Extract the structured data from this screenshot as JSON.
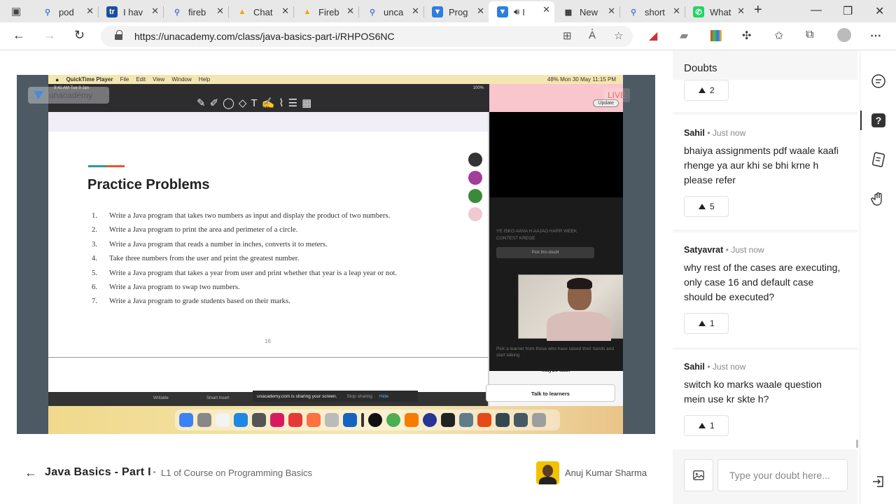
{
  "browser": {
    "tabs": [
      {
        "title": "pod",
        "icon": "search-icon",
        "fav_bg": "#e8e8e8",
        "fav_color": "#4a7bd0",
        "glyph": "⚲"
      },
      {
        "title": "I hav",
        "icon": "tr-icon",
        "fav_bg": "#1a4fa0",
        "fav_color": "#fff",
        "glyph": "tr"
      },
      {
        "title": "fireb",
        "icon": "search-icon",
        "fav_bg": "#e8e8e8",
        "fav_color": "#4a7bd0",
        "glyph": "⚲"
      },
      {
        "title": "Chat",
        "icon": "firebase-icon",
        "fav_bg": "#e8e8e8",
        "fav_color": "#f4a300",
        "glyph": "▲"
      },
      {
        "title": "Fireb",
        "icon": "firebase-icon",
        "fav_bg": "#e8e8e8",
        "fav_color": "#f4a300",
        "glyph": "▲"
      },
      {
        "title": "unca",
        "icon": "search-icon",
        "fav_bg": "#e8e8e8",
        "fav_color": "#4a7bd0",
        "glyph": "⚲"
      },
      {
        "title": "Prog",
        "icon": "unacademy-icon",
        "fav_bg": "#2f7de1",
        "fav_color": "#fff",
        "glyph": "▼"
      },
      {
        "title": "I",
        "icon": "unacademy-icon",
        "fav_bg": "#2f7de1",
        "fav_color": "#fff",
        "glyph": "▼",
        "active": true
      },
      {
        "title": "New",
        "icon": "calendar-icon",
        "fav_bg": "#e8e8e8",
        "fav_color": "#333",
        "glyph": "▦"
      },
      {
        "title": "short",
        "icon": "search-icon",
        "fav_bg": "#e8e8e8",
        "fav_color": "#4a7bd0",
        "glyph": "⚲"
      },
      {
        "title": "What",
        "icon": "whatsapp-icon",
        "fav_bg": "#25d366",
        "fav_color": "#fff",
        "glyph": "✆"
      }
    ],
    "url": "https://unacademy.com/class/java-basics-part-i/RHPOS6NC"
  },
  "video": {
    "mac_menu": [
      "QuickTime Player",
      "File",
      "Edit",
      "View",
      "Window",
      "Help"
    ],
    "mac_status": "48%   Mon 30 May  11:15 PM",
    "ipad_time": "9:41 AM  Tue 9 Jan",
    "ipad_battery": "100%",
    "slide_title": "Practice Problems",
    "problems": [
      "Write a Java program that takes two numbers as input and display the product of two numbers.",
      "Write a Java program to print the area and perimeter of a circle.",
      "Write a Java program that reads a number in inches, converts it to meters.",
      "Take three numbers from the user and print the greatest number.",
      "Write a Java program that takes a year from user and print whether that year is a leap year or not.",
      "Write a Java program to swap two numbers.",
      "Write a Java program to grade students based on their marks."
    ],
    "page_number": "16",
    "share_text": "unacademy.com is sharing your screen.",
    "stop_sharing": "Stop sharing",
    "hide": "Hide",
    "update": "Update",
    "pick_doubt": "Pick this doubt",
    "maybe_later": "Maybe later",
    "talk_to_learners": "Talk to learners",
    "live_badge": "LIVE",
    "brand": "unacademy",
    "learner_hint": "Pick a learner from those who have raised their hands and start talking",
    "you": "You",
    "doubt_overlay": "YE ISKO AANA H AAJAO HARR WEEK CONTEST KREGE",
    "dock_label_1": "Writable",
    "dock_label_2": "Smart Insert"
  },
  "course": {
    "title": "Java Basics - Part I",
    "subtitle": "L1 of Course on Programming Basics",
    "educator": "Anuj Kumar Sharma"
  },
  "doubts": {
    "title": "Doubts",
    "first_upvotes": "2",
    "items": [
      {
        "name": "Sahil",
        "time": "Just now",
        "text": "bhaiya assignments pdf waale kaafi rhenge ya aur khi se bhi krne h please refer",
        "votes": "5"
      },
      {
        "name": "Satyavrat",
        "time": "Just now",
        "text": "why rest of the cases are executing, only case 16 and default case should be executed?",
        "votes": "1"
      },
      {
        "name": "Sahil",
        "time": "Just now",
        "text": "switch ko marks waale question mein use kr skte h?",
        "votes": "1"
      }
    ],
    "input_placeholder": "Type your doubt here..."
  }
}
